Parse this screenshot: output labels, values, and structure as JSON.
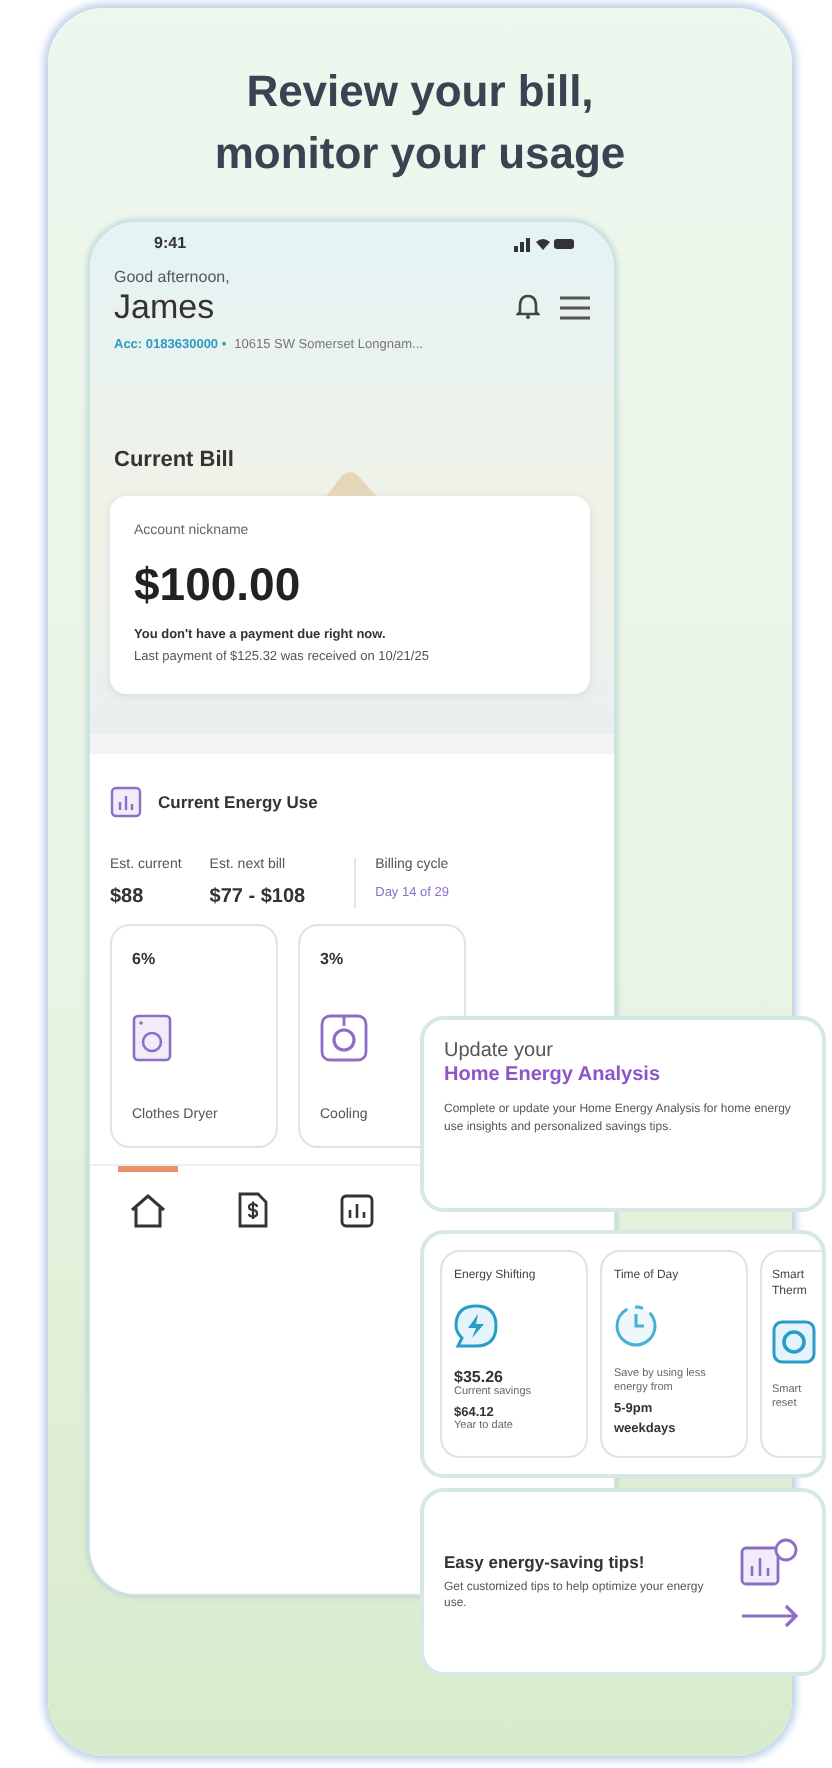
{
  "headline": [
    "Review your bill,",
    "monitor your usage"
  ],
  "status_bar": {
    "time": "9:41"
  },
  "header": {
    "greeting": "Good afternoon,",
    "name": "James",
    "account": "Acc: 0183630000 •",
    "address": "10615 SW Somerset Longnam..."
  },
  "current_bill": {
    "title": "Current Bill",
    "nickname": "Account nickname",
    "amount": "$100.00",
    "message": "You don't have a payment due right now.",
    "last_payment": "Last payment of $125.32 was received on 10/21/25"
  },
  "energy_use": {
    "title": "Current Energy Use",
    "stats": [
      {
        "label": "Est. current",
        "value": "$88",
        "kind": "amount"
      },
      {
        "label": "Est. next bill",
        "value": "$77 - $108",
        "kind": "amount"
      },
      {
        "label": "Billing cycle",
        "value": "Day 14 of 29",
        "kind": "link"
      }
    ],
    "appliances": [
      {
        "percent": "6%",
        "name": "Clothes Dryer",
        "kind": "dryer"
      },
      {
        "percent": "3%",
        "name": "Cooling",
        "kind": "ring"
      }
    ]
  },
  "bottom_nav": [
    {
      "kind": "home",
      "selected": true
    },
    {
      "kind": "bill",
      "selected": false
    },
    {
      "kind": "usage",
      "selected": false
    }
  ],
  "analysis_card": {
    "line1": "Update your",
    "line2": "Home Energy Analysis",
    "body": "Complete or update your Home Energy Analysis for home energy use insights and personalized savings tips."
  },
  "programs": [
    {
      "title": "Energy Shifting",
      "kind": "shift",
      "value": "$35.26",
      "value_label": "Current savings",
      "sub_value": "$64.12",
      "sub_label": "Year to date"
    },
    {
      "title": "Time of Day",
      "kind": "clock",
      "body": "Save by using less energy from",
      "value": "5-9pm",
      "sub_value": "weekdays"
    },
    {
      "title": "Smart Therm",
      "kind": "ring",
      "body": "Smart reset"
    }
  ],
  "tips_card": {
    "title": "Easy energy-saving tips!",
    "body": "Get customized tips to help optimize your energy use."
  }
}
